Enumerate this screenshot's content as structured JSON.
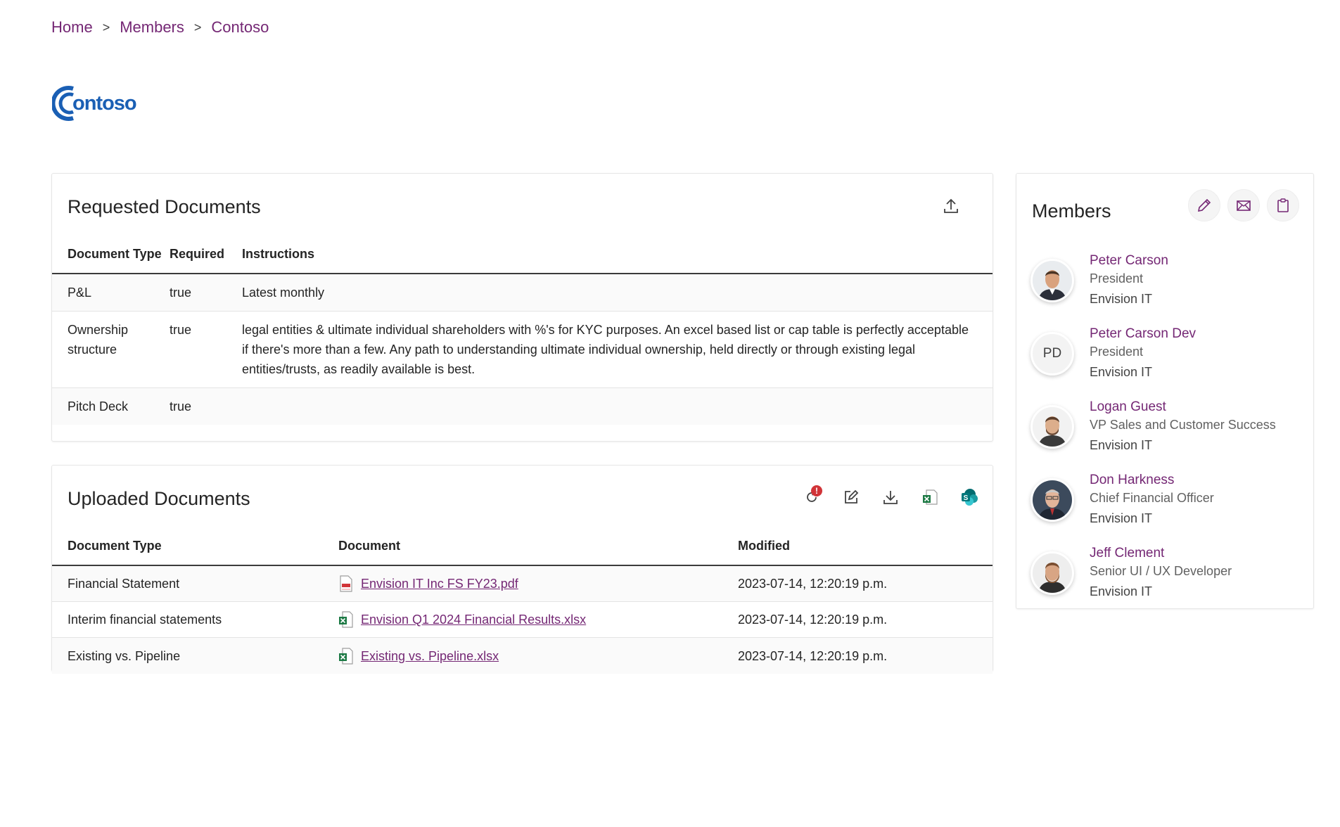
{
  "breadcrumb": {
    "home": "Home",
    "members": "Members",
    "current": "Contoso",
    "separator": ">"
  },
  "logo": {
    "text": "ontoso"
  },
  "requested": {
    "title": "Requested Documents",
    "headers": {
      "type": "Document Type",
      "required": "Required",
      "instructions": "Instructions"
    },
    "rows": [
      {
        "type": "P&L",
        "required": "true",
        "instructions": "Latest monthly"
      },
      {
        "type": "Ownership structure",
        "required": "true",
        "instructions": "legal entities & ultimate individual shareholders with %'s for KYC purposes. An excel based list or cap table is perfectly acceptable if there's more than a few. Any path to understanding ultimate individual ownership, held directly or through existing legal entities/trusts, as readily available is best."
      },
      {
        "type": "Pitch Deck",
        "required": "true",
        "instructions": ""
      }
    ]
  },
  "uploaded": {
    "title": "Uploaded Documents",
    "badge": "!",
    "headers": {
      "type": "Document Type",
      "document": "Document",
      "modified": "Modified"
    },
    "rows": [
      {
        "type": "Financial Statement",
        "document": "Envision IT Inc FS FY23.pdf",
        "file_icon": "pdf-file-icon",
        "modified": "2023-07-14, 12:20:19 p.m."
      },
      {
        "type": "Interim financial statements",
        "document": "Envision Q1 2024 Financial Results.xlsx",
        "file_icon": "excel-file-icon",
        "modified": "2023-07-14, 12:20:19 p.m."
      },
      {
        "type": "Existing vs. Pipeline",
        "document": "Existing vs. Pipeline.xlsx",
        "file_icon": "excel-file-icon",
        "modified": "2023-07-14, 12:20:19 p.m."
      }
    ]
  },
  "members": {
    "title": "Members",
    "list": [
      {
        "name": "Peter Carson",
        "role": "President",
        "org": "Envision IT",
        "initials": "",
        "avatar": "photo"
      },
      {
        "name": "Peter Carson Dev",
        "role": "President",
        "org": "Envision IT",
        "initials": "PD",
        "avatar": "initials"
      },
      {
        "name": "Logan Guest",
        "role": "VP Sales and Customer Success",
        "org": "Envision IT",
        "initials": "",
        "avatar": "photo"
      },
      {
        "name": "Don Harkness",
        "role": "Chief Financial Officer",
        "org": "Envision IT",
        "initials": "",
        "avatar": "photo"
      },
      {
        "name": "Jeff Clement",
        "role": "Senior UI / UX Developer",
        "org": "Envision IT",
        "initials": "",
        "avatar": "photo"
      }
    ]
  },
  "colors": {
    "accent": "#742774",
    "logo_blue": "#1a5fb4",
    "excel_green": "#1d7a45",
    "pdf_red": "#d13438",
    "badge_red": "#d13438"
  }
}
